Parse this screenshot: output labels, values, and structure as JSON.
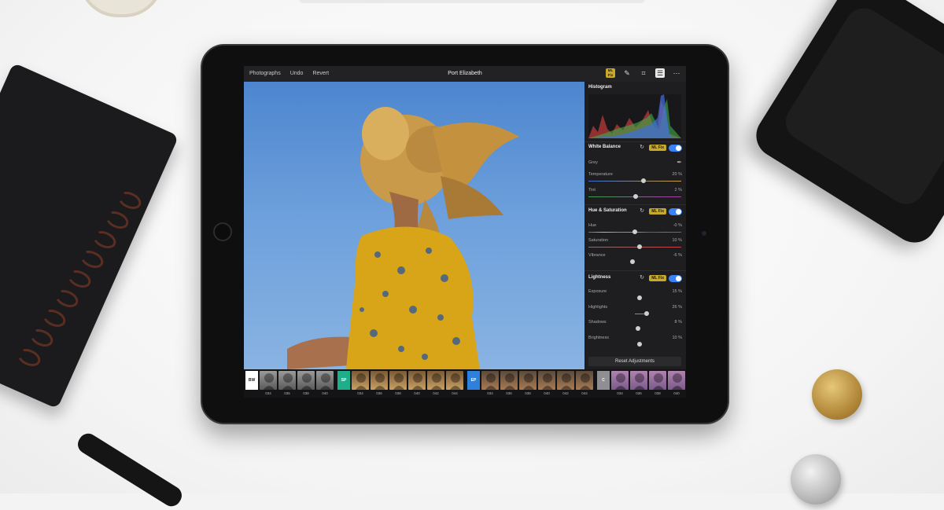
{
  "toolbar": {
    "photographs": "Photographs",
    "undo": "Undo",
    "revert": "Revert",
    "title": "Port Elizabeth",
    "icons": [
      "ml-fix-icon",
      "pencil-icon",
      "crop-icon",
      "adjustments-icon",
      "more-icon"
    ],
    "ml_badge": "ML Fix"
  },
  "panel": {
    "histogram": "Histogram",
    "white_balance": {
      "title": "White Balance",
      "ml_fix": "ML Fix",
      "grey": "Grey",
      "temperature": {
        "label": "Temperature",
        "value": "20 %",
        "level": 0.6
      },
      "tint": {
        "label": "Tint",
        "value": "2 %",
        "level": 0.51
      }
    },
    "hue_saturation": {
      "title": "Hue & Saturation",
      "ml_fix": "ML Fix",
      "hue": {
        "label": "Hue",
        "value": "-0 %",
        "level": 0.5
      },
      "saturation": {
        "label": "Saturation",
        "value": "10 %",
        "level": 0.55
      },
      "vibrance": {
        "label": "Vibrance",
        "value": "-6 %",
        "level": 0.47
      }
    },
    "lightness": {
      "title": "Lightness",
      "ml_fix": "ML Fix",
      "exposure": {
        "label": "Exposure",
        "value": "15 %",
        "level": 0.55
      },
      "highlights": {
        "label": "Highlights",
        "value": "26 %",
        "level": 0.63
      },
      "shadows": {
        "label": "Shadows",
        "value": "8 %",
        "level": 0.54
      },
      "brightness": {
        "label": "Brightness",
        "value": "10 %",
        "level": 0.55
      }
    },
    "reset": "Reset Adjustments"
  },
  "filmstrip": {
    "groups": [
      {
        "tag": "BW",
        "tag_color": "#ffffff",
        "tag_text": "#222222",
        "labels": [
          "034",
          "036",
          "038",
          "040"
        ],
        "tone": "grey"
      },
      {
        "tag": "SP",
        "tag_color": "#1fae8a",
        "tag_text": "#ffffff",
        "labels": [
          "034",
          "036",
          "038",
          "040",
          "042",
          "044"
        ],
        "tone": "warm"
      },
      {
        "tag": "EP",
        "tag_color": "#2f7fdc",
        "tag_text": "#ffffff",
        "labels": [
          "034",
          "036",
          "038",
          "040",
          "042",
          "044"
        ],
        "tone": "earth"
      },
      {
        "tag": "C",
        "tag_color": "#8e8e93",
        "tag_text": "#ffffff",
        "labels": [
          "034",
          "036",
          "038",
          "040"
        ],
        "tone": "purple"
      }
    ]
  },
  "colors": {
    "accent": "#3b82f6",
    "ml_fix": "#c8a92a",
    "dress": "#d8a418",
    "sky": "#6c9fdb"
  }
}
